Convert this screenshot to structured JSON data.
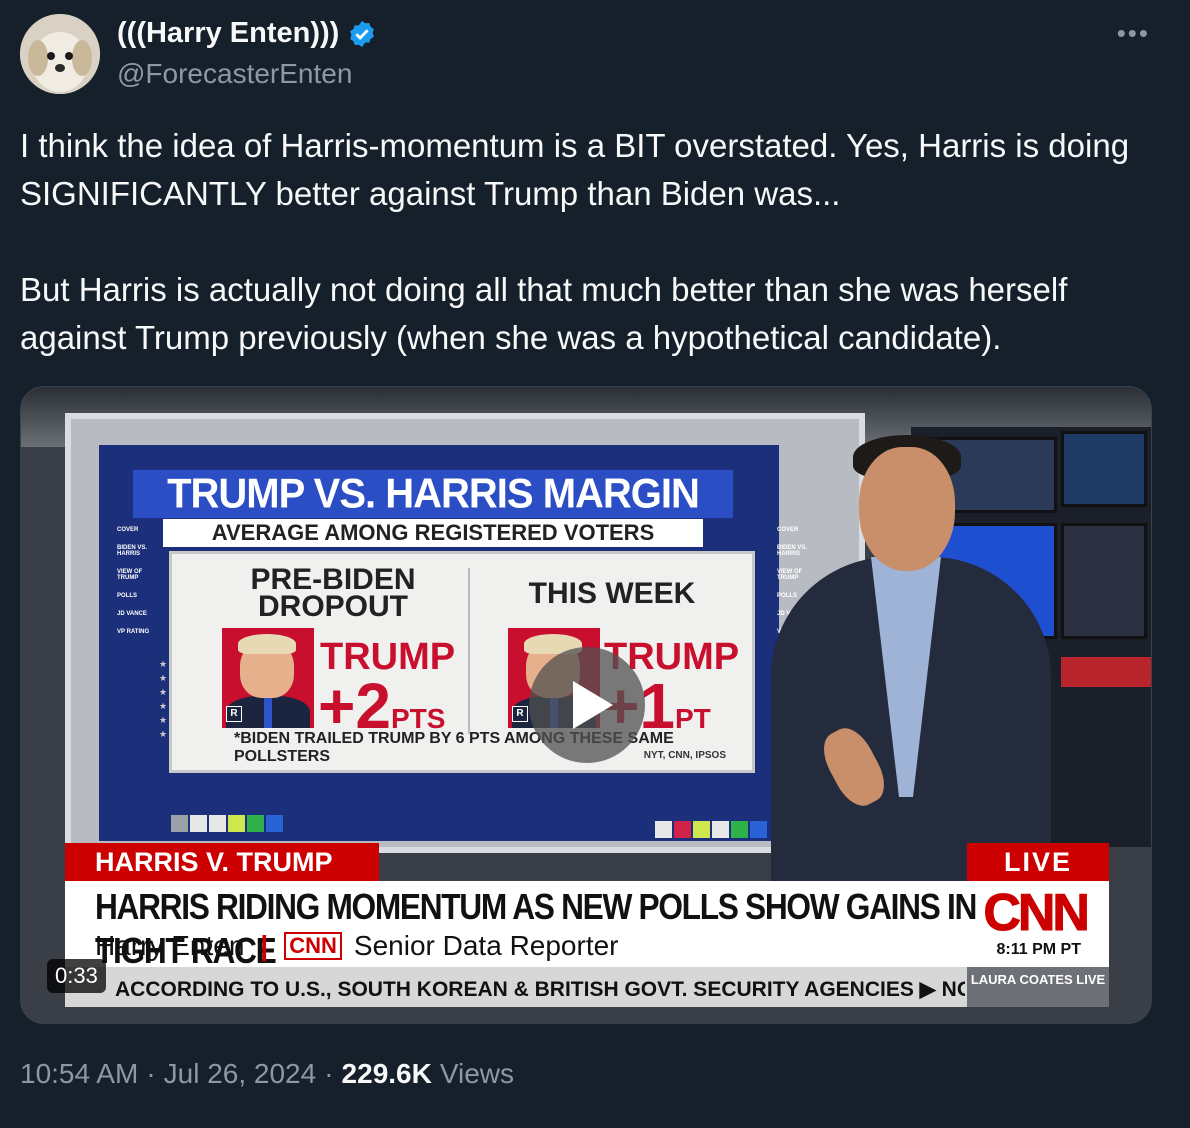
{
  "author": {
    "name": "(((Harry Enten)))",
    "handle": "@ForecasterEnten",
    "verified": true,
    "avatar_icon": "dog-avatar"
  },
  "more_icon": "more-options-icon",
  "tweet": {
    "paragraph1": "I think the idea of Harris-momentum is a BIT overstated. Yes, Harris is doing SIGNIFICANTLY better against Trump than Biden was...",
    "paragraph2": "But Harris is actually not doing all that much better than she was herself against Trump previously (when she was a hypothetical candidate)."
  },
  "video": {
    "duration": "0:33",
    "play_icon": "play-icon",
    "graphic": {
      "title": "TRUMP VS. HARRIS MARGIN",
      "subtitle": "AVERAGE AMONG REGISTERED VOTERS",
      "left_head": "PRE-BIDEN DROPOUT",
      "left_label": "TRUMP",
      "left_value": "+2",
      "left_unit": "PTS",
      "right_head": "THIS WEEK",
      "right_label": "TRUMP",
      "right_value": "+1",
      "right_unit": "PT",
      "party_tag": "R",
      "footnote": "*BIDEN TRAILED TRUMP BY 6 PTS AMONG THESE SAME POLLSTERS",
      "source": "NYT, CNN, IPSOS",
      "side_nav": [
        "COVER",
        "BIDEN VS. HARRIS",
        "VIEW OF TRUMP",
        "POLLS",
        "JD VANCE",
        "VP RATING"
      ]
    },
    "chyron": {
      "tag": "HARRIS V. TRUMP",
      "live": "LIVE",
      "headline": "HARRIS RIDING MOMENTUM AS NEW POLLS SHOW GAINS IN TIGHT RACE",
      "reporter": "Harry Enten",
      "network_small": "CNN",
      "role": "Senior Data Reporter",
      "network_logo": "CNN",
      "time": "8:11 PM PT"
    },
    "ticker": {
      "text": "ACCORDING TO U.S., SOUTH KOREAN & BRITISH GOVT. SECURITY AGENCIES   ▶ NOR",
      "show": "LAURA COATES LIVE"
    }
  },
  "meta": {
    "time": "10:54 AM",
    "date": "Jul 26, 2024",
    "views_count": "229.6K",
    "views_label": "Views"
  },
  "colors": {
    "background": "#15202b",
    "verified": "#1d9bf0",
    "cnn_red": "#cc0000",
    "secondary_text": "#8b98a5"
  }
}
